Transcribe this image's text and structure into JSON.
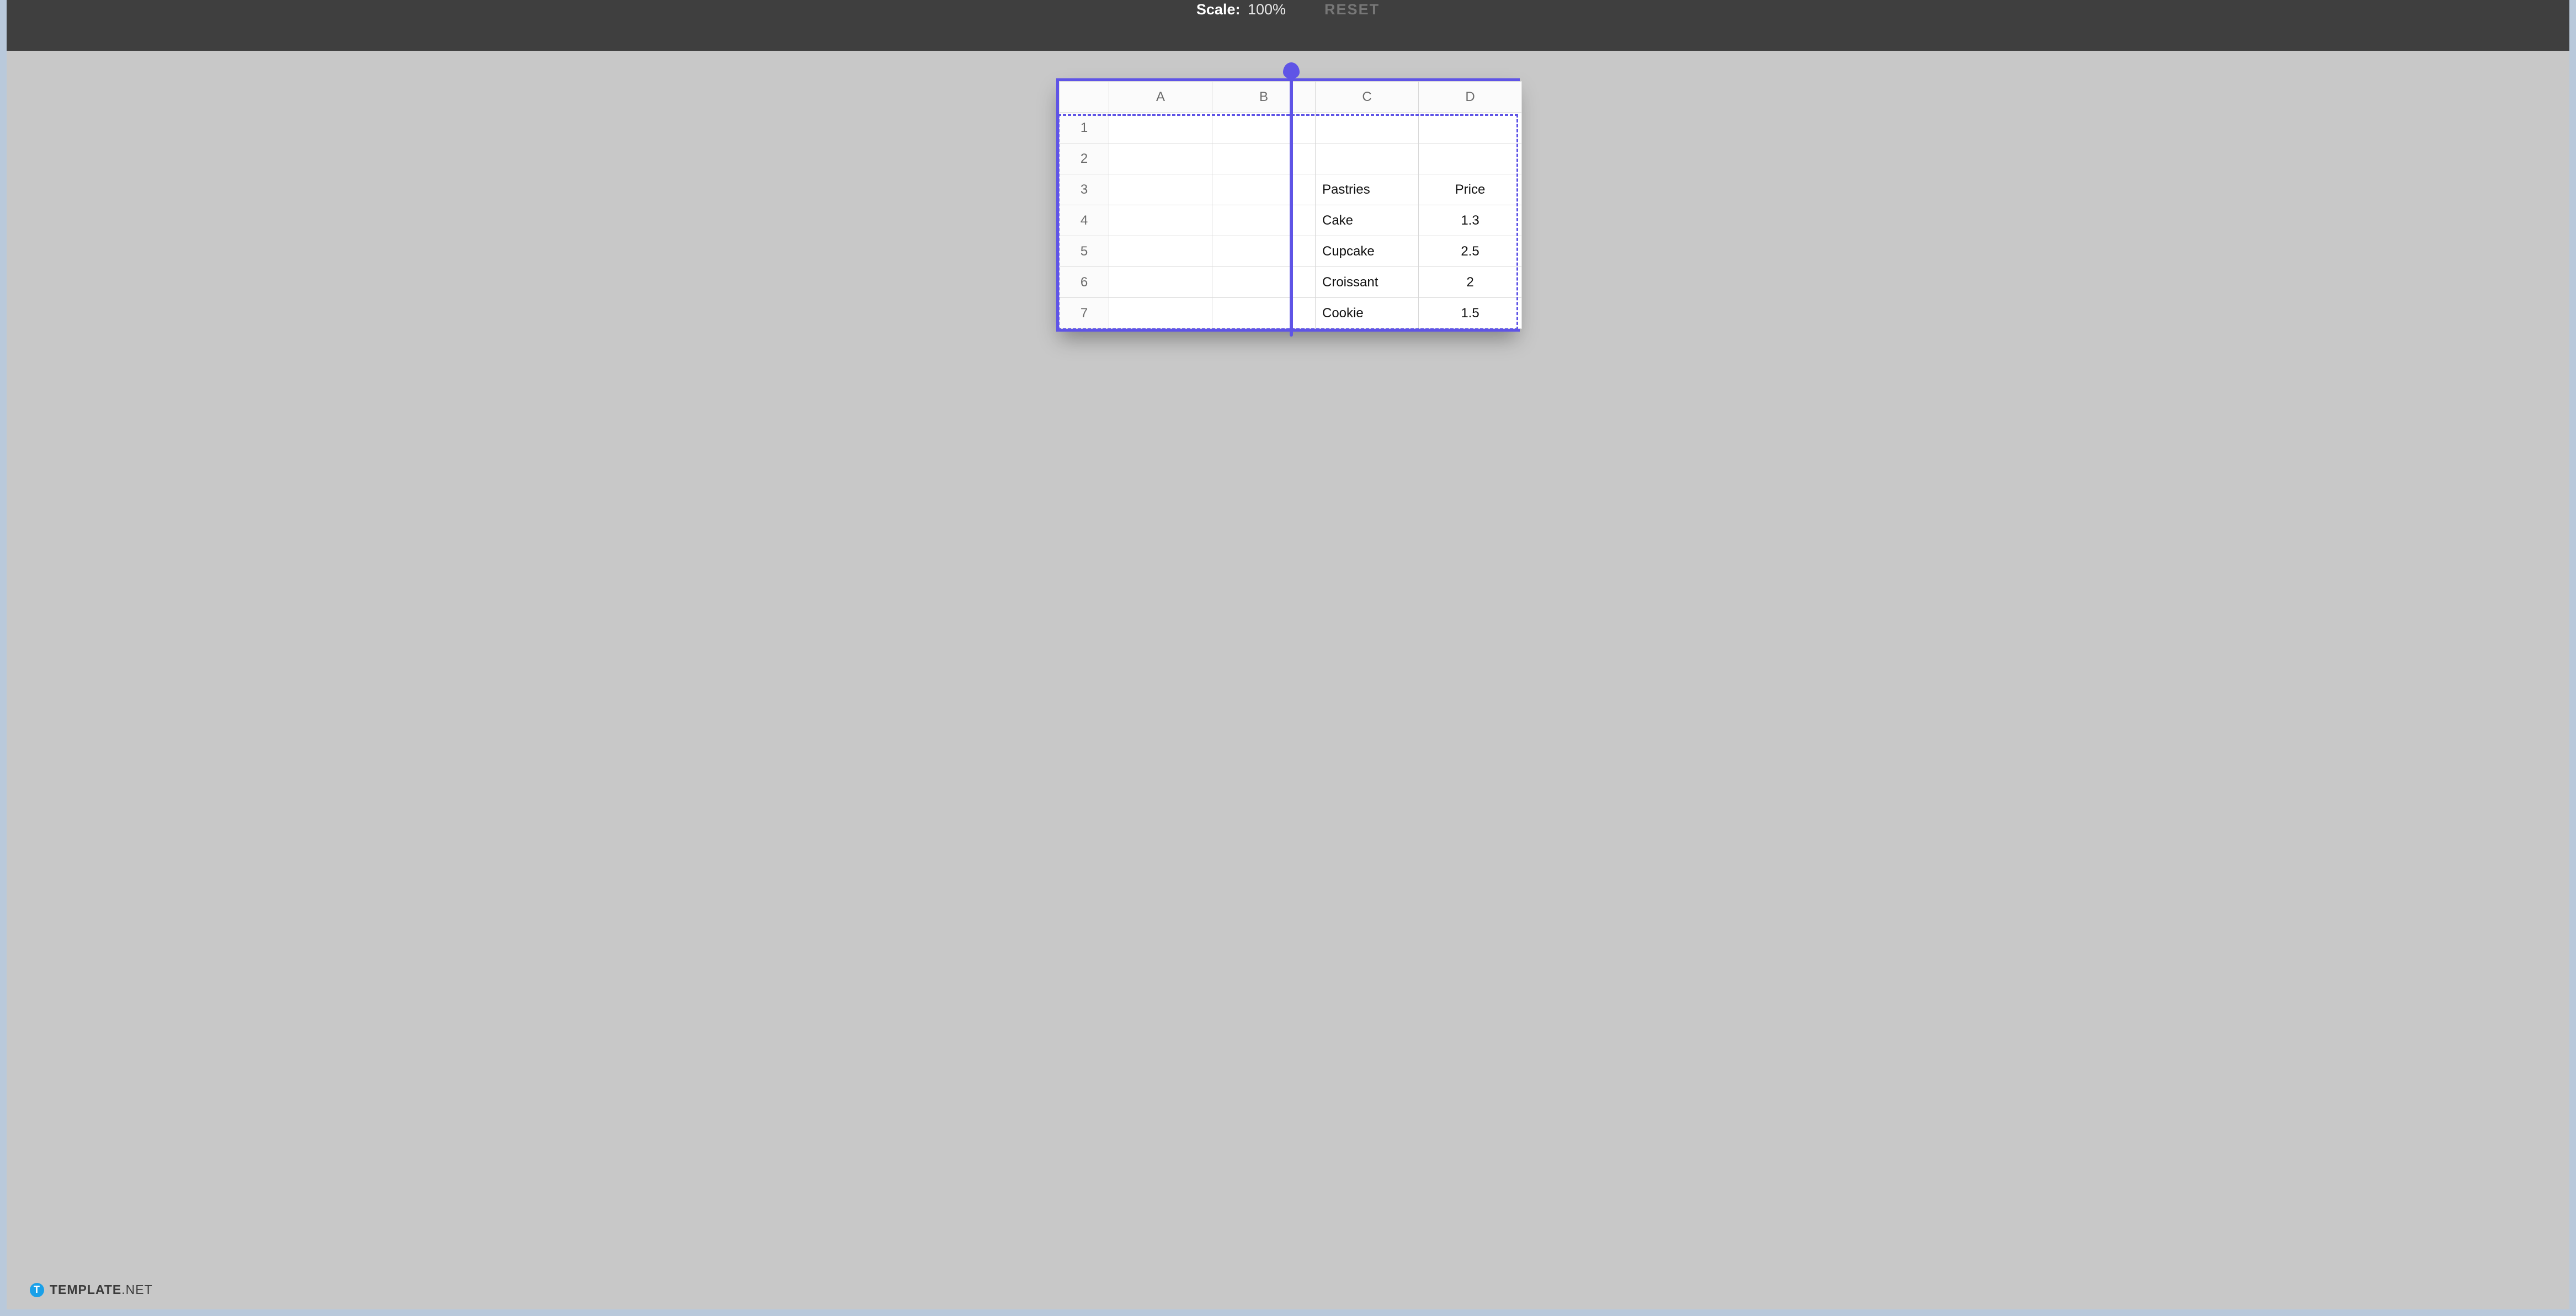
{
  "toolbar": {
    "scale_label": "Scale:",
    "scale_value": "100%",
    "reset_label": "RESET"
  },
  "sheet": {
    "columns": [
      "A",
      "B",
      "C",
      "D"
    ],
    "rows": [
      "1",
      "2",
      "3",
      "4",
      "5",
      "6",
      "7"
    ],
    "cells": {
      "C3": "Pastries",
      "D3": "Price",
      "C4": "Cake",
      "D4": "1.3",
      "C5": "Cupcake",
      "D5": "2.5",
      "C6": "Croissant",
      "D6": "2",
      "C7": "Cookie",
      "D7": "1.5"
    }
  },
  "watermark": {
    "logo_letter": "T",
    "brand_bold": "TEMPLATE",
    "brand_thin": ".NET"
  },
  "chart_data": {
    "type": "table",
    "title": "",
    "columns_used": [
      "C",
      "D"
    ],
    "header": {
      "C": "Pastries",
      "D": "Price"
    },
    "rows": [
      {
        "Pastries": "Cake",
        "Price": 1.3
      },
      {
        "Pastries": "Cupcake",
        "Price": 2.5
      },
      {
        "Pastries": "Croissant",
        "Price": 2
      },
      {
        "Pastries": "Cookie",
        "Price": 1.5
      }
    ]
  }
}
